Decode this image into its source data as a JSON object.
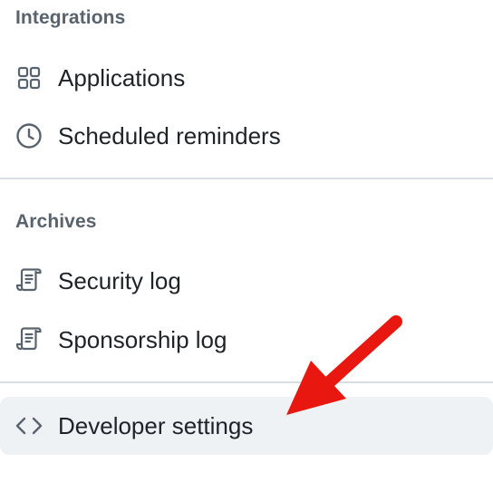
{
  "sections": {
    "integrations": {
      "heading": "Integrations",
      "items": [
        {
          "label": "Applications",
          "icon": "apps-grid-icon"
        },
        {
          "label": "Scheduled reminders",
          "icon": "clock-icon"
        }
      ]
    },
    "archives": {
      "heading": "Archives",
      "items": [
        {
          "label": "Security log",
          "icon": "log-scroll-icon"
        },
        {
          "label": "Sponsorship log",
          "icon": "log-scroll-icon"
        }
      ]
    },
    "developer": {
      "label": "Developer settings",
      "icon": "code-icon"
    }
  },
  "annotation": {
    "arrow_color": "#e8170f"
  }
}
